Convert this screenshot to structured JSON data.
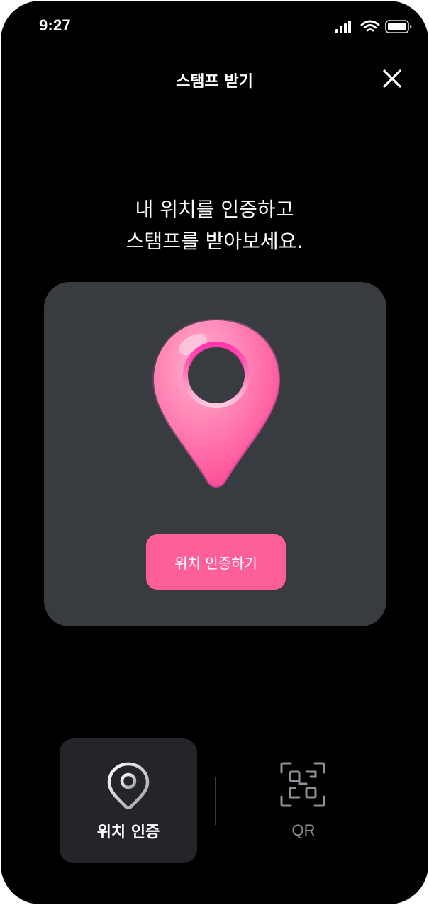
{
  "status_bar": {
    "time": "9:27",
    "icons": [
      "signal-icon",
      "wifi-icon",
      "battery-icon"
    ]
  },
  "header": {
    "title": "스탬프 받기",
    "close_icon": "close-icon"
  },
  "headline": {
    "line1": "내 위치를 인증하고",
    "line2": "스탬프를 받아보세요."
  },
  "card": {
    "illustration": "location-pin-icon",
    "button_label": "위치 인증하기"
  },
  "tabs": [
    {
      "label": "위치 인증",
      "icon": "location-pin-icon",
      "selected": true
    },
    {
      "label": "QR",
      "icon": "qr-code-icon",
      "selected": false
    }
  ],
  "colors": {
    "background": "#000000",
    "card": "#383b40",
    "accent": "#ff5f99",
    "tab_selected_bg": "#23252a",
    "tab_inactive_text": "#8e9196"
  }
}
